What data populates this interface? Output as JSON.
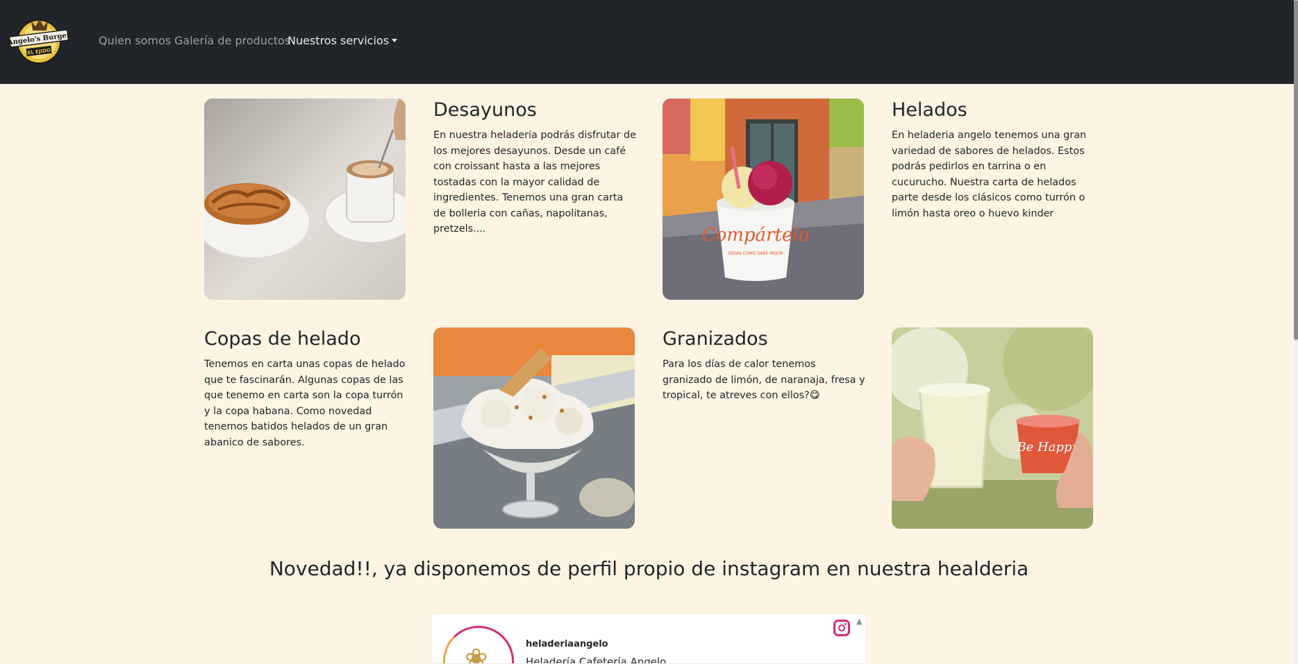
{
  "nav": {
    "logo_text": "Angelo's Burger",
    "logo_sub": "EL EJIDO",
    "links": [
      "Quien somos",
      "Galería de productos"
    ],
    "dropdown_label": "Nuestros servicios"
  },
  "services": [
    {
      "title": "Desayunos",
      "text": "En nuestra heladeria podrás disfrutar de los mejores desayunos. Desde un café con croissant hasta a las mejores tostadas con la mayor calidad de ingredientes. Tenemos una gran carta de bolleria con cañas, napolitanas, pretzels...."
    },
    {
      "title": "Helados",
      "text": "En heladeria angelo tenemos una gran variedad de sabores de helados. Estos podrás pedirlos en tarrina o en cucurucho. Nuestra carta de helados parte desde los clásicos como turrón o limón hasta oreo o huevo kinder",
      "cup_text": "Compártelo",
      "cup_subtext": "SEKAS COMO SABE MEJOR"
    },
    {
      "title": "Copas de helado",
      "text": "Tenemos en carta unas copas de helado que te fascinarán. Algunas copas de las que tenemo en carta son la copa turrón y la copa habana. Como novedad tenemos batidos helados de un gran abanico de sabores."
    },
    {
      "title": "Granizados",
      "text": "Para los días de calor tenemos granizado de limón, de naranaja, fresa y tropical, te atreves con ellos?😋",
      "cup_text": "Be Happy"
    }
  ],
  "headline": "Novedad!!, ya disponemos de perfil propio de instagram en nuestra healderia",
  "instagram": {
    "username": "heladeriaangelo",
    "display_name": "Heladería Cafetería Angelo"
  },
  "colors": {
    "navbar": "#212529",
    "page_background": "#fdf4e3",
    "instagram_accent": "#d62976"
  }
}
